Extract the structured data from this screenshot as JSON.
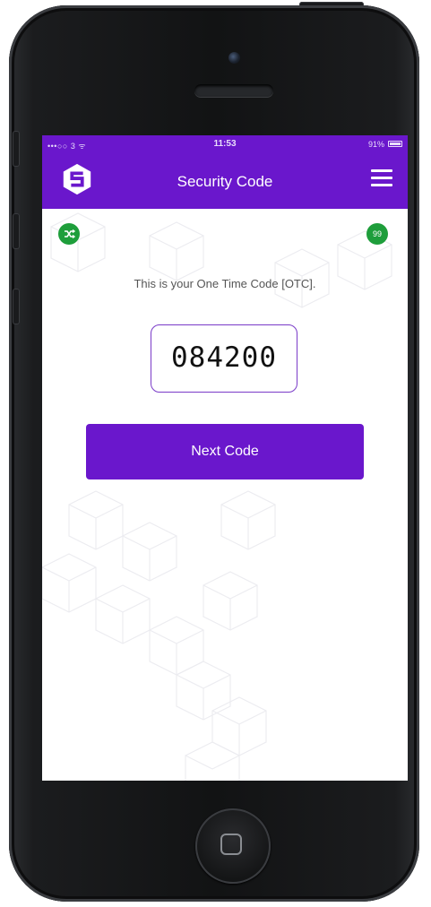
{
  "status_bar": {
    "carrier": "•••○○ 3 ᯤ",
    "time": "11:53",
    "battery": "91%"
  },
  "header": {
    "title": "Security Code",
    "logo_icon": "hexagon-s-logo",
    "menu_icon": "hamburger-menu-icon"
  },
  "badges": {
    "left_icon": "shuffle-icon",
    "right_label": "99"
  },
  "main": {
    "info_text": "This is your One Time Code [OTC].",
    "code": "084200",
    "next_button_label": "Next Code"
  },
  "colors": {
    "brand_purple": "#6a17cc",
    "badge_green": "#1e9e3b",
    "code_border": "#7a3bc8"
  }
}
